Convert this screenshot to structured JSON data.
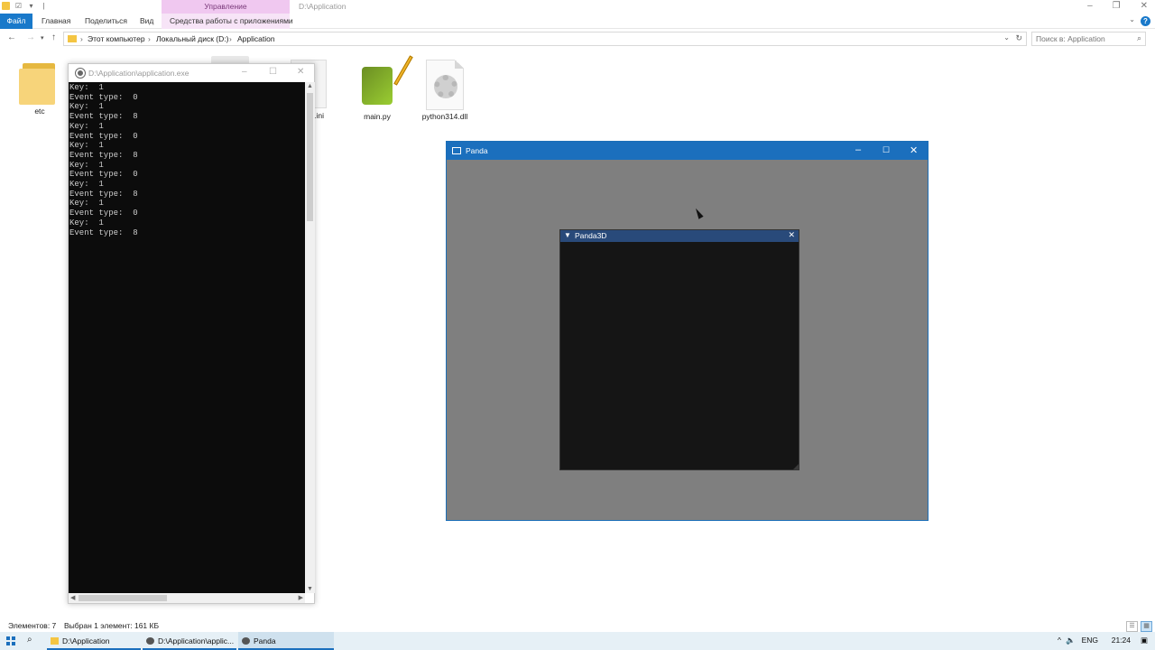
{
  "explorer": {
    "window_title": "D:\\Application",
    "context_tab": "Управление",
    "tabs": [
      "Файл",
      "Главная",
      "Поделиться",
      "Вид",
      "Средства работы с приложениями"
    ],
    "breadcrumb": [
      "Этот компьютер",
      "Локальный диск (D:)",
      "Application"
    ],
    "search_placeholder": "Поиск в: Application",
    "files": [
      {
        "name": "etc",
        "type": "folder"
      },
      {
        "name": "...ini",
        "type": "ini"
      },
      {
        "name": "main.py",
        "type": "python"
      },
      {
        "name": "python314.dll",
        "type": "dll"
      }
    ],
    "status_items": "Элементов: 7",
    "status_selected": "Выбран 1 элемент: 161 КБ"
  },
  "console": {
    "title": "D:\\Application\\application.exe",
    "lines": [
      "Key:  1",
      "Event type:  0",
      "Key:  1",
      "Event type:  8",
      "Key:  1",
      "Event type:  0",
      "Key:  1",
      "Event type:  8",
      "Key:  1",
      "Event type:  0",
      "Key:  1",
      "Event type:  8",
      "Key:  1",
      "Event type:  0",
      "Key:  1",
      "Event type:  8"
    ]
  },
  "panda_window": {
    "title": "Panda",
    "imgui_title": "Panda3D"
  },
  "taskbar": {
    "items": [
      {
        "label": "D:\\Application"
      },
      {
        "label": "D:\\Application\\applic..."
      },
      {
        "label": "Panda"
      }
    ],
    "lang": "ENG",
    "time": "21:24"
  },
  "colors": {
    "accent": "#1b6fbd",
    "ribbon_file_tab": "#1979ca",
    "context_tab": "#f0c8f0",
    "console_bg": "#0c0c0c",
    "console_text": "#cccccc",
    "panda_bg": "#7f7f7f",
    "imgui_title": "#294a7a",
    "imgui_bg": "#151515"
  }
}
